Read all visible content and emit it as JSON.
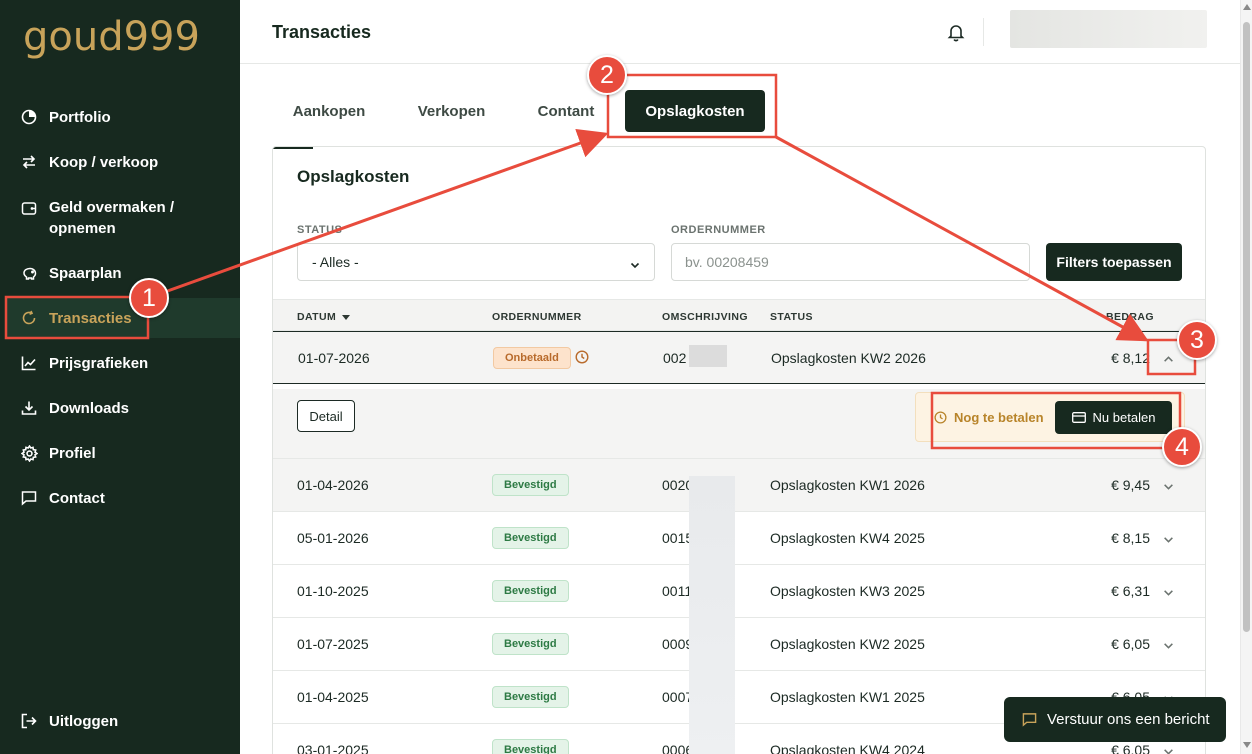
{
  "app": {
    "logo_text": "goud999",
    "page_title": "Transacties"
  },
  "sidebar": {
    "items": [
      {
        "label": "Portfolio",
        "icon": "pie-chart-icon"
      },
      {
        "label": "Koop / verkoop",
        "icon": "swap-arrows-icon"
      },
      {
        "label_line1": "Geld overmaken /",
        "label_line2": "opnemen",
        "icon": "wallet-icon"
      },
      {
        "label": "Spaarplan",
        "icon": "piggy-bank-icon"
      },
      {
        "label": "Transacties",
        "icon": "refresh-icon",
        "active": true
      },
      {
        "label": "Prijsgrafieken",
        "icon": "line-chart-icon"
      },
      {
        "label": "Downloads",
        "icon": "download-icon"
      },
      {
        "label": "Profiel",
        "icon": "gear-icon"
      },
      {
        "label": "Contact",
        "icon": "chat-icon"
      }
    ],
    "logout_label": "Uitloggen"
  },
  "tabs": [
    {
      "label": "Aankopen"
    },
    {
      "label": "Verkopen"
    },
    {
      "label": "Contant"
    },
    {
      "label": "Opslagkosten",
      "active": true
    }
  ],
  "card": {
    "title": "Opslagkosten",
    "filters": {
      "status_label": "STATUS",
      "status_value": "- Alles -",
      "order_label": "ORDERNUMMER",
      "order_placeholder": "bv. 00208459",
      "apply_label": "Filters toepassen"
    },
    "columns": [
      "DATUM",
      "ORDERNUMMER",
      "OMSCHRIJVING",
      "STATUS",
      "BEDRAG"
    ],
    "rows": [
      {
        "date": "01-07-2026",
        "badge": "Onbetaald",
        "order": "002",
        "desc": "Opslagkosten KW2 2026",
        "amount": "€ 8,12"
      },
      {
        "date": "01-04-2026",
        "badge": "Bevestigd",
        "order": "0020",
        "desc": "Opslagkosten KW1 2026",
        "amount": "€ 9,45"
      },
      {
        "date": "05-01-2026",
        "badge": "Bevestigd",
        "order": "0015",
        "desc": "Opslagkosten KW4 2025",
        "amount": "€ 8,15"
      },
      {
        "date": "01-10-2025",
        "badge": "Bevestigd",
        "order": "0011",
        "desc": "Opslagkosten KW3 2025",
        "amount": "€ 6,31"
      },
      {
        "date": "01-07-2025",
        "badge": "Bevestigd",
        "order": "0009",
        "desc": "Opslagkosten KW2 2025",
        "amount": "€ 6,05"
      },
      {
        "date": "01-04-2025",
        "badge": "Bevestigd",
        "order": "0007",
        "desc": "Opslagkosten KW1 2025",
        "amount": "€ 6,05"
      },
      {
        "date": "03-01-2025",
        "badge": "Bevestigd",
        "order": "0006",
        "desc": "Opslagkosten KW4 2024",
        "amount": "€ 6,05"
      }
    ],
    "expanded": {
      "detail_label": "Detail",
      "due_label": "Nog te betalen",
      "pay_label": "Nu betalen"
    }
  },
  "chat": {
    "label": "Verstuur ons een bericht"
  },
  "annotations": {
    "markers": [
      "1",
      "2",
      "3",
      "4"
    ],
    "color": "#e84c3d"
  },
  "colors": {
    "sidebar_bg": "#17291f",
    "accent_gold": "#c8a35a",
    "primary_button": "#17291f"
  }
}
